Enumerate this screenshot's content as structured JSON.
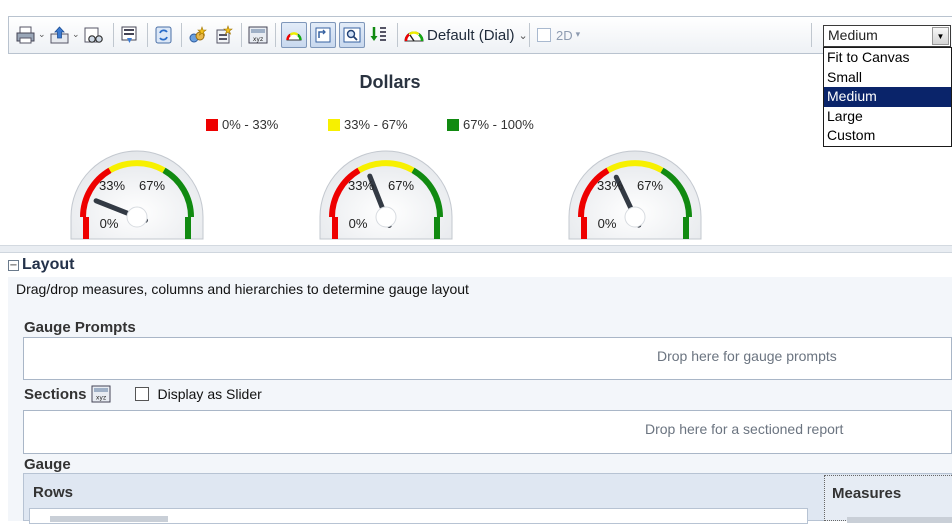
{
  "toolbar": {
    "buttons": [
      {
        "name": "print-icon",
        "has_menu": true
      },
      {
        "name": "export-icon",
        "has_menu": true
      },
      {
        "name": "preview-icon",
        "has_menu": false
      },
      {
        "name": "edit-view-icon",
        "has_menu": false
      },
      {
        "name": "refresh-icon",
        "has_menu": false
      },
      {
        "name": "new-calculated-item-icon",
        "has_menu": false
      },
      {
        "name": "new-group-icon",
        "has_menu": false
      },
      {
        "name": "section-slider-icon",
        "has_menu": false
      },
      {
        "name": "gauge-type-icon",
        "pressed": true
      },
      {
        "name": "zoom-fit-icon",
        "pressed": true
      },
      {
        "name": "zoom-icon",
        "pressed": true
      },
      {
        "name": "sort-icon",
        "pressed": false
      }
    ],
    "style_label": "Default (Dial)",
    "dimension_label": "2D",
    "dimension_checked": false
  },
  "size_select": {
    "value": "Medium",
    "options": [
      "Fit to Canvas",
      "Small",
      "Medium",
      "Large",
      "Custom"
    ],
    "selected_index": 2
  },
  "chart": {
    "title": "Dollars",
    "legend": [
      {
        "label": "0% - 33%",
        "color": "#ee0000"
      },
      {
        "label": "33% - 67%",
        "color": "#f7f000"
      },
      {
        "label": "67% - 100%",
        "color": "#118a11"
      }
    ],
    "gauges": [
      {
        "label_min": "0%",
        "label_33": "33%",
        "label_67": "67%",
        "needle_value": 0.12
      },
      {
        "label_min": "0%",
        "label_33": "33%",
        "label_67": "67%",
        "needle_value": 0.38
      },
      {
        "label_min": "0%",
        "label_33": "33%",
        "label_67": "67%",
        "needle_value": 0.36
      }
    ]
  },
  "layout_panel": {
    "title": "Layout",
    "instructions": "Drag/drop measures, columns and hierarchies to determine gauge layout",
    "gauge_prompts_label": "Gauge Prompts",
    "gauge_prompts_drop": "Drop here for gauge prompts",
    "sections_label": "Sections",
    "display_as_slider_label": "Display as Slider",
    "display_as_slider_checked": false,
    "sections_drop": "Drop here for a sectioned report",
    "gauge_label": "Gauge",
    "rows_label": "Rows",
    "measures_label": "Measures"
  }
}
